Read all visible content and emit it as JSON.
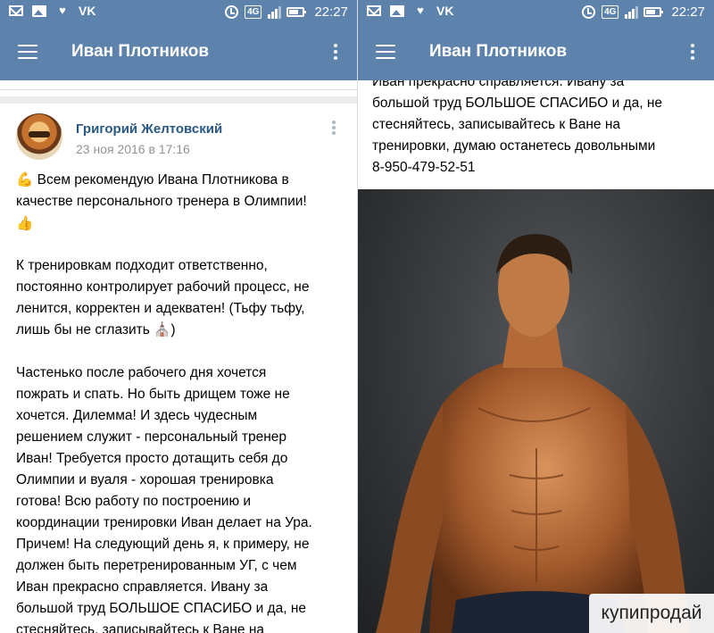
{
  "status_bar": {
    "time": "22:27",
    "network": "4G",
    "icons": [
      "mail-icon",
      "image-icon",
      "heart-icon",
      "vk-icon",
      "alarm-icon",
      "signal-icon",
      "battery-icon"
    ],
    "vk_label": "VK"
  },
  "app_bar": {
    "title": "Иван Плотников",
    "background": "#5d83ad"
  },
  "post": {
    "author": "Григорий Желтовский",
    "date": "23 ноя 2016 в 17:16",
    "paragraph1": [
      "💪 Всем рекомендую Ивана Плотникова в",
      "качестве персонального тренера в Олимпии!",
      "👍"
    ],
    "paragraph2": [
      "К тренировкам подходит ответственно,",
      "постоянно контролирует рабочий процесс, не",
      "ленится, корректен и адекватен! (Тьфу тьфу,",
      "лишь бы не сглазить ⛪)"
    ],
    "paragraph3": [
      "Частенько после рабочего дня хочется",
      "пожрать и спать. Но быть дрищем тоже не",
      "хочется. Дилемма! И здесь чудесным",
      "решением служит - персональный тренер",
      "Иван! Требуется просто дотащить себя до",
      "Олимпии и вуаля - хорошая тренировка",
      "готова! Всю работу по построению и",
      "координации тренировки Иван делает на Ура.",
      "Причем! На следующий день я, к примеру, не",
      "должен быть перетренированным УГ, с чем",
      "Иван прекрасно справляется. Ивану за",
      "большой труд БОЛЬШОЕ СПАСИБО и да, не",
      "стесняйтесь, записывайтесь к Ване на"
    ]
  },
  "right_post_text": [
    "Иван прекрасно справляется. Ивану за",
    "большой труд БОЛЬШОЕ СПАСИБО и да, не",
    "стесняйтесь, записывайтесь к Ване на",
    "тренировки, думаю останетесь довольными",
    "8-950-479-52-51"
  ],
  "watermark": "купипродай"
}
